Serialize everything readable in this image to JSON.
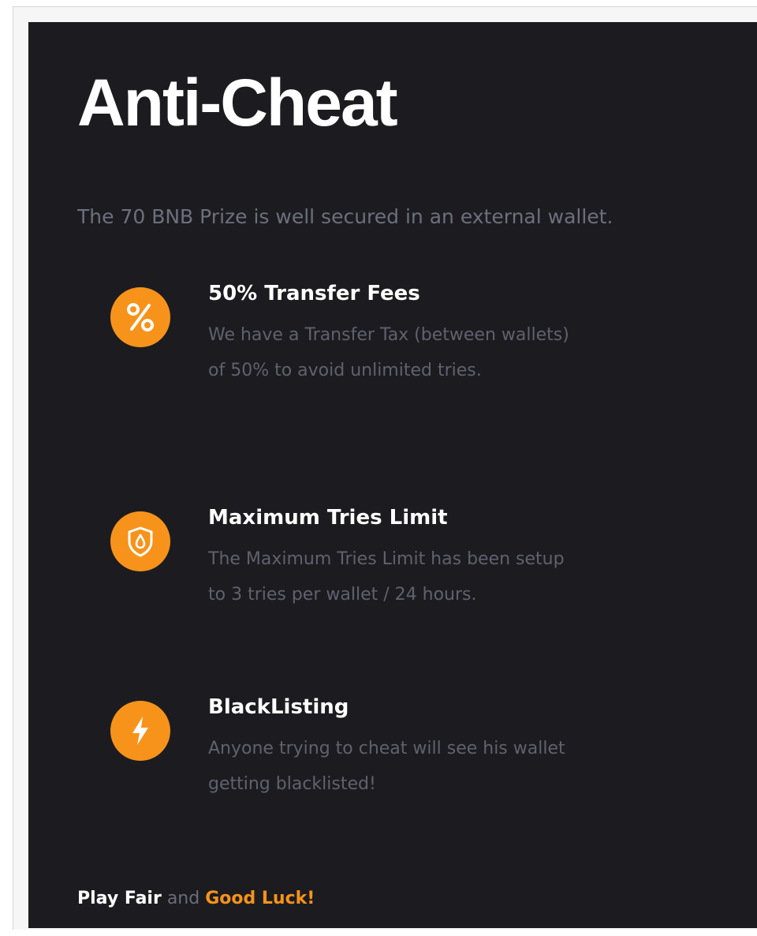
{
  "section": {
    "title": "Anti-Cheat",
    "subtitle": "The 70 BNB Prize is well secured in an external wallet."
  },
  "features": [
    {
      "icon": "percent-icon",
      "heading": "50% Transfer Fees",
      "text": "We have a Transfer Tax (between wallets) of 50% to avoid unlimited tries."
    },
    {
      "icon": "shield-icon",
      "heading": "Maximum Tries Limit",
      "text": "The Maximum Tries Limit has been setup to 3 tries per wallet / 24 hours."
    },
    {
      "icon": "lightning-icon",
      "heading": "BlackListing",
      "text": "Anyone trying to cheat will see his wallet getting blacklisted!"
    }
  ],
  "footer": {
    "part1": "Play Fair",
    "part2": "and",
    "part3": "Good Luck!"
  },
  "colors": {
    "background": "#1c1c20",
    "accent": "#f7931a",
    "heading": "#ffffff",
    "body_text": "#5f616e"
  }
}
